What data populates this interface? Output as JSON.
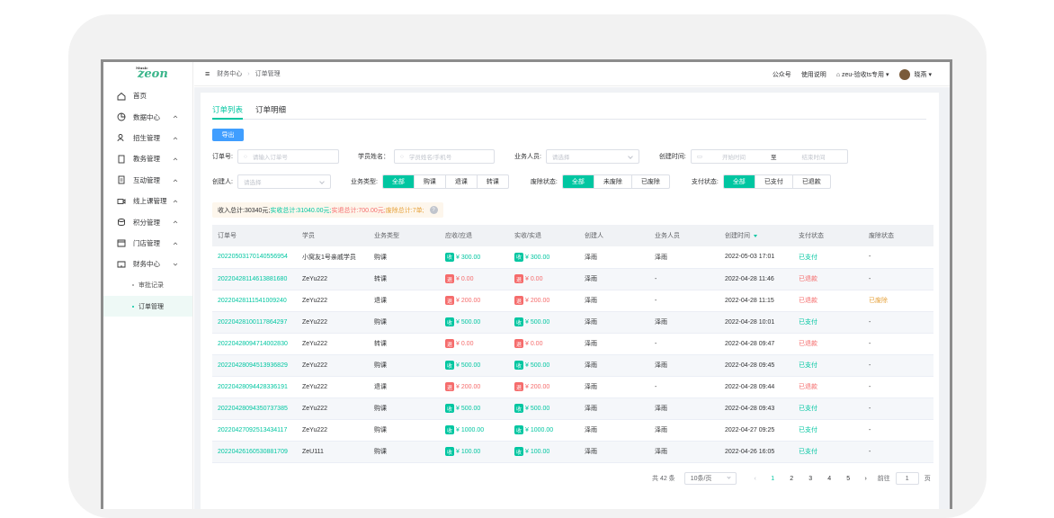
{
  "logo": {
    "small": "Music",
    "text": "zeon"
  },
  "sidebar": {
    "items": [
      {
        "label": "首页",
        "icon": "home-icon"
      },
      {
        "label": "数据中心",
        "icon": "pie-chart-icon"
      },
      {
        "label": "招生管理",
        "icon": "users-icon"
      },
      {
        "label": "教务管理",
        "icon": "book-icon"
      },
      {
        "label": "互动管理",
        "icon": "document-icon"
      },
      {
        "label": "线上课管理",
        "icon": "video-icon"
      },
      {
        "label": "积分管理",
        "icon": "coins-icon"
      },
      {
        "label": "门店管理",
        "icon": "store-icon"
      },
      {
        "label": "财务中心",
        "icon": "wallet-icon"
      },
      {
        "label": "审批记录"
      },
      {
        "label": "订单管理"
      }
    ]
  },
  "topbar": {
    "crumb1": "财务中心",
    "crumb2": "订单管理",
    "link1": "公众号",
    "link2": "使用说明",
    "store": "zeu-验收ts专用",
    "user": "晓燕"
  },
  "tabs": {
    "list": "订单列表",
    "detail": "订单明细"
  },
  "export_label": "导出",
  "filters": {
    "order_no_label": "订单号:",
    "order_no_placeholder": "请输入订单号",
    "student_label": "学员姓名：",
    "student_placeholder": "学员姓名/手机号",
    "sales_label": "业务人员:",
    "sales_placeholder": "请选择",
    "created_label": "创建时间:",
    "start_placeholder": "开始时间",
    "to": "至",
    "end_placeholder": "结束时间",
    "creator_label": "创建人:",
    "creator_placeholder": "请选择",
    "biz_type_label": "业务类型:",
    "biz_type_options": [
      "全部",
      "购课",
      "退课",
      "转课"
    ],
    "void_label": "废除状态:",
    "void_options": [
      "全部",
      "未废除",
      "已废除"
    ],
    "pay_label": "支付状态:",
    "pay_options": [
      "全部",
      "已支付",
      "已退款"
    ]
  },
  "summary": {
    "income": "收入总计:30340元;",
    "actual": "实收总计:31040.00元;",
    "refund": "实退总计:700.00元;",
    "voided": "废除总计:7单;"
  },
  "table": {
    "headers": [
      "订单号",
      "学员",
      "业务类型",
      "应收/应退",
      "实收/实退",
      "创建人",
      "业务人员",
      "创建时间",
      "支付状态",
      "废除状态"
    ],
    "rows": [
      {
        "id": "2022050317014055695​4",
        "student": "小窝友1号亲戚学员",
        "type": "购课",
        "kind": "收",
        "due": "¥ 300.00",
        "paid": "¥ 300.00",
        "creator": "泽雨",
        "sales": "泽雨",
        "time": "2022-05-03 17:01",
        "pay": "已支付",
        "void": "-"
      },
      {
        "id": "20220428114613881680",
        "student": "ZeYu222",
        "type": "转课",
        "kind": "退",
        "due": "¥ 0.00",
        "paid": "¥ 0.00",
        "creator": "泽雨",
        "sales": "-",
        "time": "2022-04-28 11:46",
        "pay": "已退款",
        "void": "-"
      },
      {
        "id": "20220428111541009240",
        "student": "ZeYu222",
        "type": "退课",
        "kind": "退",
        "due": "¥ 200.00",
        "paid": "¥ 200.00",
        "creator": "泽雨",
        "sales": "-",
        "time": "2022-04-28 11:15",
        "pay": "已退款",
        "void": "已废除"
      },
      {
        "id": "20220428100117864297",
        "student": "ZeYu222",
        "type": "购课",
        "kind": "收",
        "due": "¥ 500.00",
        "paid": "¥ 500.00",
        "creator": "泽雨",
        "sales": "泽雨",
        "time": "2022-04-28 10:01",
        "pay": "已支付",
        "void": "-"
      },
      {
        "id": "20220428094714002830",
        "student": "ZeYu222",
        "type": "转课",
        "kind": "退",
        "due": "¥ 0.00",
        "paid": "¥ 0.00",
        "creator": "泽雨",
        "sales": "-",
        "time": "2022-04-28 09:47",
        "pay": "已退款",
        "void": "-"
      },
      {
        "id": "20220428094513936829",
        "student": "ZeYu222",
        "type": "购课",
        "kind": "收",
        "due": "¥ 500.00",
        "paid": "¥ 500.00",
        "creator": "泽雨",
        "sales": "泽雨",
        "time": "2022-04-28 09:45",
        "pay": "已支付",
        "void": "-"
      },
      {
        "id": "20220428094428336191",
        "student": "ZeYu222",
        "type": "退课",
        "kind": "退",
        "due": "¥ 200.00",
        "paid": "¥ 200.00",
        "creator": "泽雨",
        "sales": "-",
        "time": "2022-04-28 09:44",
        "pay": "已退款",
        "void": "-"
      },
      {
        "id": "20220428094350737385",
        "student": "ZeYu222",
        "type": "购课",
        "kind": "收",
        "due": "¥ 500.00",
        "paid": "¥ 500.00",
        "creator": "泽雨",
        "sales": "泽雨",
        "time": "2022-04-28 09:43",
        "pay": "已支付",
        "void": "-"
      },
      {
        "id": "20220427092513434117",
        "student": "ZeYu222",
        "type": "购课",
        "kind": "收",
        "due": "¥ 1000.00",
        "paid": "¥ 1000.00",
        "creator": "泽雨",
        "sales": "泽雨",
        "time": "2022-04-27 09:25",
        "pay": "已支付",
        "void": "-"
      },
      {
        "id": "20220426160530881709",
        "student": "ZeU111",
        "type": "购课",
        "kind": "收",
        "due": "¥ 100.00",
        "paid": "¥ 100.00",
        "creator": "泽雨",
        "sales": "泽雨",
        "time": "2022-04-26 16:05",
        "pay": "已支付",
        "void": "-"
      }
    ]
  },
  "pagination": {
    "total": "共 42 条",
    "page_size": "10条/页",
    "pages": [
      "1",
      "2",
      "3",
      "4",
      "5"
    ],
    "goto_label": "前往",
    "goto_value": "1",
    "page_unit": "页"
  }
}
